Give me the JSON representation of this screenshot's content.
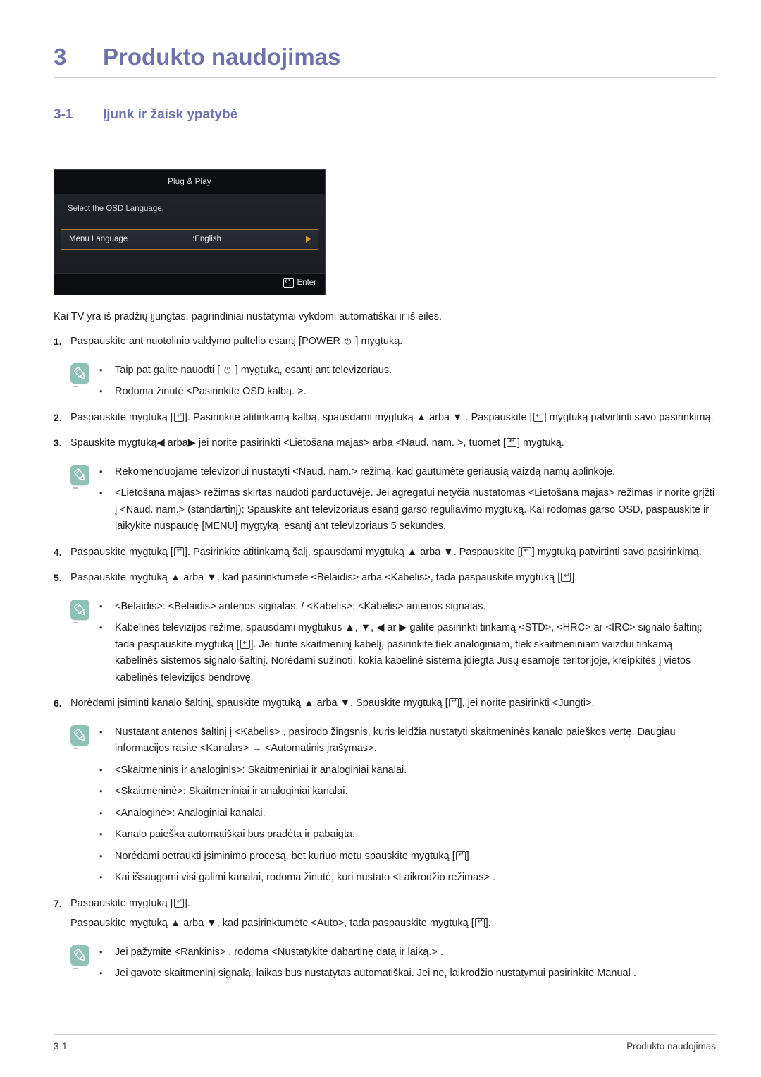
{
  "chapter": {
    "number": "3",
    "title": "Produkto naudojimas"
  },
  "section": {
    "number": "3-1",
    "title": "Įjunk ir žaisk ypatybė"
  },
  "osd": {
    "title": "Plug & Play",
    "prompt": "Select the OSD Language.",
    "row_label": "Menu Language",
    "row_value": ":English",
    "enter_label": "Enter",
    "highlight_color": "#9e7c33",
    "background_color": "#16181d"
  },
  "intro": "Kai TV yra iš pradžių įjungtas, pagrindiniai nustatymai vykdomi automatiškai ir iš eilės.",
  "steps": [
    {
      "num": "1.",
      "text_before": "Paspauskite ant nuotolinio valdymo pultelio esantį [POWER ",
      "text_after": " ] mygtuką."
    },
    {
      "num": "2.",
      "parts": [
        "Paspauskite mygtuką [",
        "]. Pasirinkite atitinkamą kalbą, spausdami mygtuką ▲ arba ▼ . Paspauskite [",
        "] mygtuką patvirtinti savo pasirinkimą."
      ]
    },
    {
      "num": "3.",
      "parts": [
        "Spauskite mygtuką◀ arba▶ jei norite pasirinkti <Lietošana mājās> arba <Naud. nam. >, tuomet [",
        "] mygtuką."
      ]
    },
    {
      "num": "4.",
      "parts": [
        "Paspauskite mygtuką [",
        "]. Pasirinkite atitinkamą šalį, spausdami mygtuką ▲ arba ▼. Paspauskite [",
        "] mygtuką patvirtinti savo pasirinkimą."
      ]
    },
    {
      "num": "5.",
      "parts": [
        "Paspauskite mygtuką ▲ arba ▼, kad pasirinktumėte <Belaidis> arba <Kabelis>, tada paspauskite mygtuką [",
        "]."
      ]
    },
    {
      "num": "6.",
      "parts": [
        "Norėdami įsiminti kanalo šaltinį, spauskite mygtuką ▲ arba ▼. Spauskite mygtuką [",
        "], jei norite pasirinkti <Jungti>."
      ]
    },
    {
      "num": "7.",
      "parts": [
        "Paspauskite mygtuką [",
        "]."
      ],
      "sub_parts": [
        "Paspauskite mygtuką ▲ arba ▼, kad pasirinktumėte <Auto>, tada paspauskite mygtuką [",
        "]."
      ]
    }
  ],
  "notes": {
    "note1": [
      {
        "parts": [
          "Taip pat galite nauodti [ ",
          " ] mygtuką, esantį ant televizoriaus."
        ],
        "glyph": "power"
      },
      {
        "text": "Rodoma žinutė <Pasirinkite OSD kalbą. >."
      }
    ],
    "note2": [
      {
        "text": "Rekomenduojame televizoriui nustatyti <Naud. nam.> režimą, kad gautumėte geriausią vaizdą namų aplinkoje."
      },
      {
        "text": "<Lietošana mājās> režimas skirtas naudoti parduotuvėje. Jei agregatui netyčia nustatomas <Lietošana mājās> režimas ir norite grįžti į <Naud. nam.> (standartinį): Spauskite ant televizoriaus esantį garso reguliavimo mygtuką. Kai rodomas garso OSD, paspauskite ir laikykite nuspaudę [MENU] mygtyką, esantį ant televizoriaus 5 sekundes."
      }
    ],
    "note3": [
      {
        "text": "<Belaidis>: <Belaidis> antenos signalas. / <Kabelis>: <Kabelis> antenos signalas."
      },
      {
        "parts": [
          "Kabelinės televizijos režime, spausdami mygtukus ▲, ▼, ◀ ar ▶ galite pasirinkti tinkamą <STD>, <HRC> ar <IRC> signalo šaltinį; tada paspauskite mygtuką [",
          "]. Jei turite skaitmeninį kabelį, pasirinkite tiek analoginiam, tiek skaitmeniniam vaizdui tinkamą kabelinės sistemos signalo šaltinį. Norėdami sužinoti, kokia kabelinė sistema įdiegta Jūsų esamoje teritorijoje, kreipkitės į vietos kabelinės televizijos bendrovę."
        ],
        "glyph": "enter"
      }
    ],
    "note4": [
      {
        "text": "Nustatant antenos šaltinį į <Kabelis> , pasirodo žingsnis, kuris leidžia nustatyti skaitmeninės kanalo paieškos vertę. Daugiau informacijos rasite <Kanalas> → <Automatinis įrašymas>."
      },
      {
        "text": "<Skaitmeninis ir analoginis>: Skaitmeniniai ir analoginiai kanalai."
      },
      {
        "text": "<Skaitmeninė>: Skaitmeniniai ir analoginiai kanalai."
      },
      {
        "text": "<Analoginė>: Analoginiai kanalai."
      },
      {
        "text": "Kanalo paieška automatiškai bus pradėta ir pabaigta."
      },
      {
        "parts": [
          "Norėdami petraukti įsiminimo procesą, bet kuriuo metu spauskite mygtuką [",
          "]"
        ],
        "glyph": "enter"
      },
      {
        "text": "Kai išsaugomi visi galimi kanalai, rodoma žinutė, kuri nustato <Laikrodžio režimas> ."
      }
    ],
    "note5": [
      {
        "text": "Jei pažymite <Rankinis> , rodoma <Nustatykite dabartinę datą ir laiką.> ."
      },
      {
        "text": "Jei gavote skaitmeninį signalą, laikas bus nustatytas automatiškai. Jei ne, laikrodžio nustatymui pasirinkite Manual ."
      }
    ]
  },
  "footer": {
    "left": "3-1",
    "right": "Produkto naudojimas"
  },
  "colors": {
    "heading": "#6f73ab",
    "note_icon": "#8fc2b6",
    "body_text": "#1f1f1f"
  },
  "icons": {
    "note": "pencil-icon",
    "enter": "enter-key-icon",
    "power": "power-icon"
  }
}
